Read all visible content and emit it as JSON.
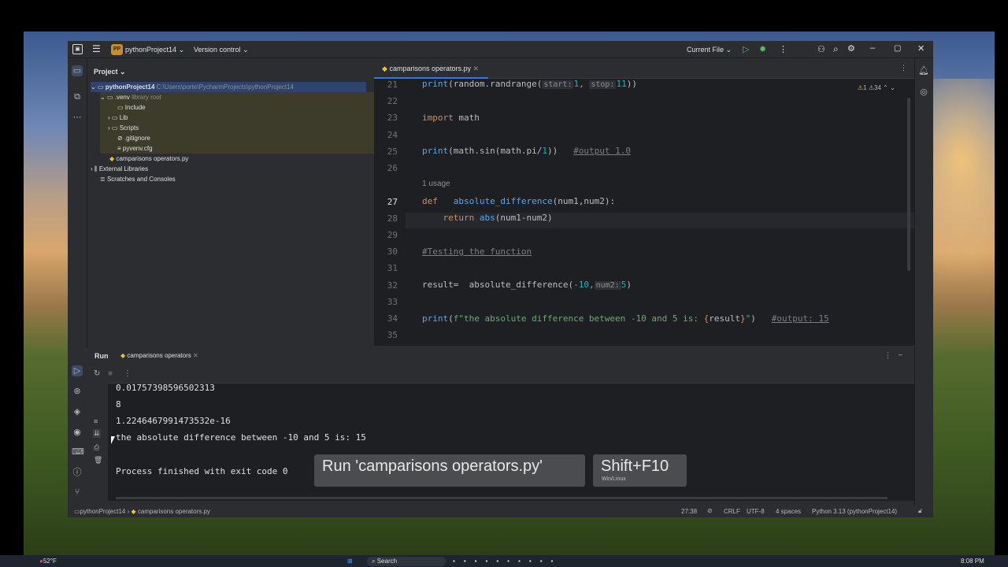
{
  "titlebar": {
    "project_badge": "PP",
    "project_name": "pythonProject14",
    "vcs": "Version control",
    "run_config": "Current File"
  },
  "project_panel": {
    "header": "Project",
    "tree": [
      {
        "label": "pythonProject14",
        "path": "C:\\Users\\porte\\PycharmProjects\\pythonProject14"
      },
      {
        "label": ".venv",
        "note": "library root"
      },
      {
        "label": "Include"
      },
      {
        "label": "Lib"
      },
      {
        "label": "Scripts"
      },
      {
        "label": ".gitignore"
      },
      {
        "label": "pyvenv.cfg"
      },
      {
        "label": "camparisons operators.py"
      },
      {
        "label": "External Libraries"
      },
      {
        "label": "Scratches and Consoles"
      }
    ]
  },
  "editor": {
    "tab_label": "camparisons operators.py",
    "inspections": {
      "warnings": "1",
      "weak": "34"
    },
    "usage_hint": "1 usage",
    "line_numbers": [
      "21",
      "22",
      "23",
      "24",
      "25",
      "26",
      "27",
      "28",
      "29",
      "30",
      "31",
      "32",
      "33",
      "34",
      "35"
    ],
    "code": {
      "l21_fn": "print",
      "l21_a": "(random.randrange(",
      "l21_hint1": "start:",
      "l21_v1": "1",
      "l21_comma": ",",
      "l21_hint2": "stop:",
      "l21_v2": "11",
      "l21_end": "))",
      "l23_kw": "import",
      "l23_rest": " math",
      "l25_fn": "print",
      "l25_a": "(math.sin(math.pi/",
      "l25_num": "1",
      "l25_b": "))   ",
      "l25_cm": "#output 1.0",
      "l27_kw": "def",
      "l27_sp": "   ",
      "l27_fn": "absolute_difference",
      "l27_rest": "(num1,num2):",
      "l28_kw": "    return",
      "l28_fn": " abs",
      "l28_rest": "(num1-num2)",
      "l30_cm": "#Testing the function",
      "l32_a": "result=  ",
      "l32_fn": "absolute_difference",
      "l32_b": "(",
      "l32_num": "-10",
      "l32_comma": ",",
      "l32_hint": "num2:",
      "l32_num2": "5",
      "l32_end": ")",
      "l34_fn": "print",
      "l34_a": "(",
      "l34_str1": "f\"the absolute difference between -10 and 5 is: ",
      "l34_brace1": "{",
      "l34_var": "result",
      "l34_brace2": "}",
      "l34_str2": "\"",
      "l34_end": ")   ",
      "l34_cm": "#output: 15"
    }
  },
  "run_panel": {
    "title": "Run",
    "tab_label": "camparisons operators",
    "output": [
      "0.01757398596502313",
      "8",
      "1.2246467991473532e-16",
      "the absolute difference between -10 and 5 is: 15",
      "",
      "Process finished with exit code 0"
    ]
  },
  "tooltip": {
    "action": "Run 'camparisons operators.py'",
    "shortcut": "Shift+F10",
    "shortcut_note": "Win/Linux"
  },
  "statusbar": {
    "breadcrumb_project": "pythonProject14",
    "breadcrumb_file": "camparisons operators.py",
    "position": "27:38",
    "line_sep": "CRLF",
    "encoding": "UTF-8",
    "indent": "4 spaces",
    "interpreter": "Python 3.13 (pythonProject14)"
  },
  "taskbar": {
    "weather": "52°F",
    "search": "Search",
    "time": "8:08 PM"
  },
  "colors": {
    "accent": "#3574f0",
    "ide_bg": "#1e1f22",
    "panel_bg": "#2b2d30",
    "keyword": "#cf8e6d",
    "function": "#56a8f5"
  }
}
